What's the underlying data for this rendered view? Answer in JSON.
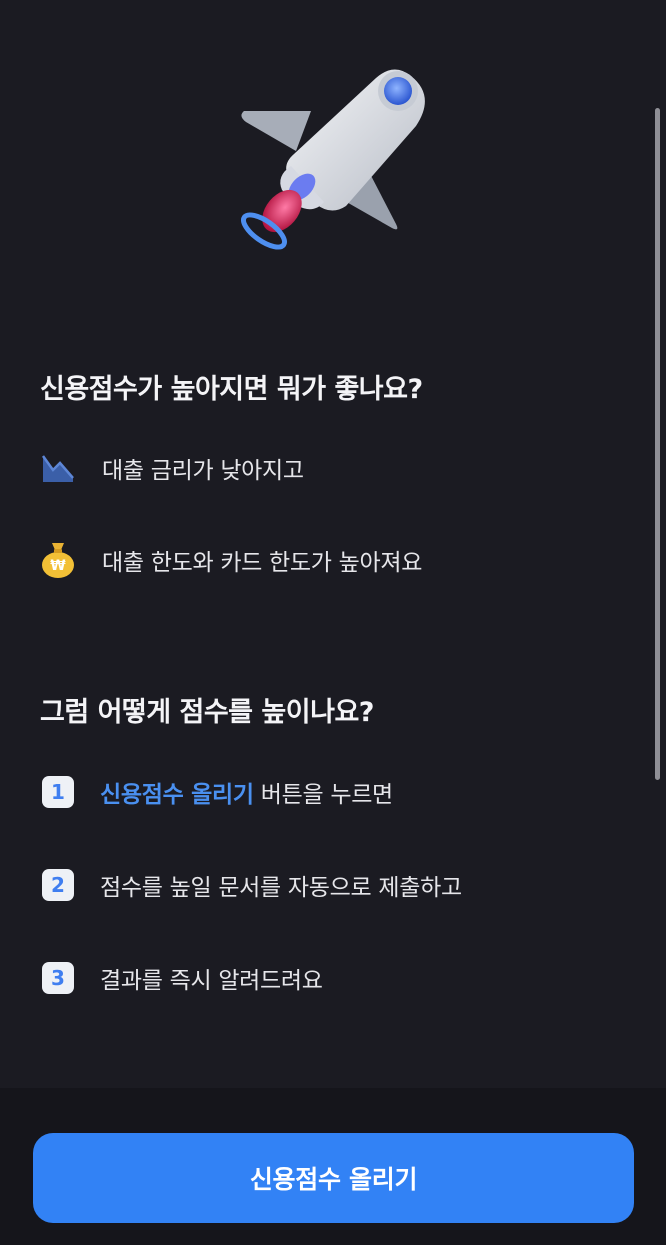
{
  "benefits": {
    "title": "신용점수가 높아지면 뭐가 좋나요?",
    "items": [
      {
        "icon": "chart-down-icon",
        "text": "대출 금리가 낮아지고"
      },
      {
        "icon": "money-bag-icon",
        "text": "대출 한도와 카드 한도가 높아져요"
      }
    ]
  },
  "howto": {
    "title": "그럼 어떻게 점수를 높이나요?",
    "steps": [
      {
        "number": "1",
        "highlight": "신용점수 올리기",
        "text": " 버튼을 누르면"
      },
      {
        "number": "2",
        "text": "점수를 높일 문서를 자동으로 제출하고"
      },
      {
        "number": "3",
        "text": "결과를 즉시 알려드려요"
      }
    ]
  },
  "cta": {
    "label": "신용점수 올리기"
  },
  "colors": {
    "accent": "#3282f5",
    "background": "#1b1b22",
    "badge_text": "#3f7ef0"
  }
}
